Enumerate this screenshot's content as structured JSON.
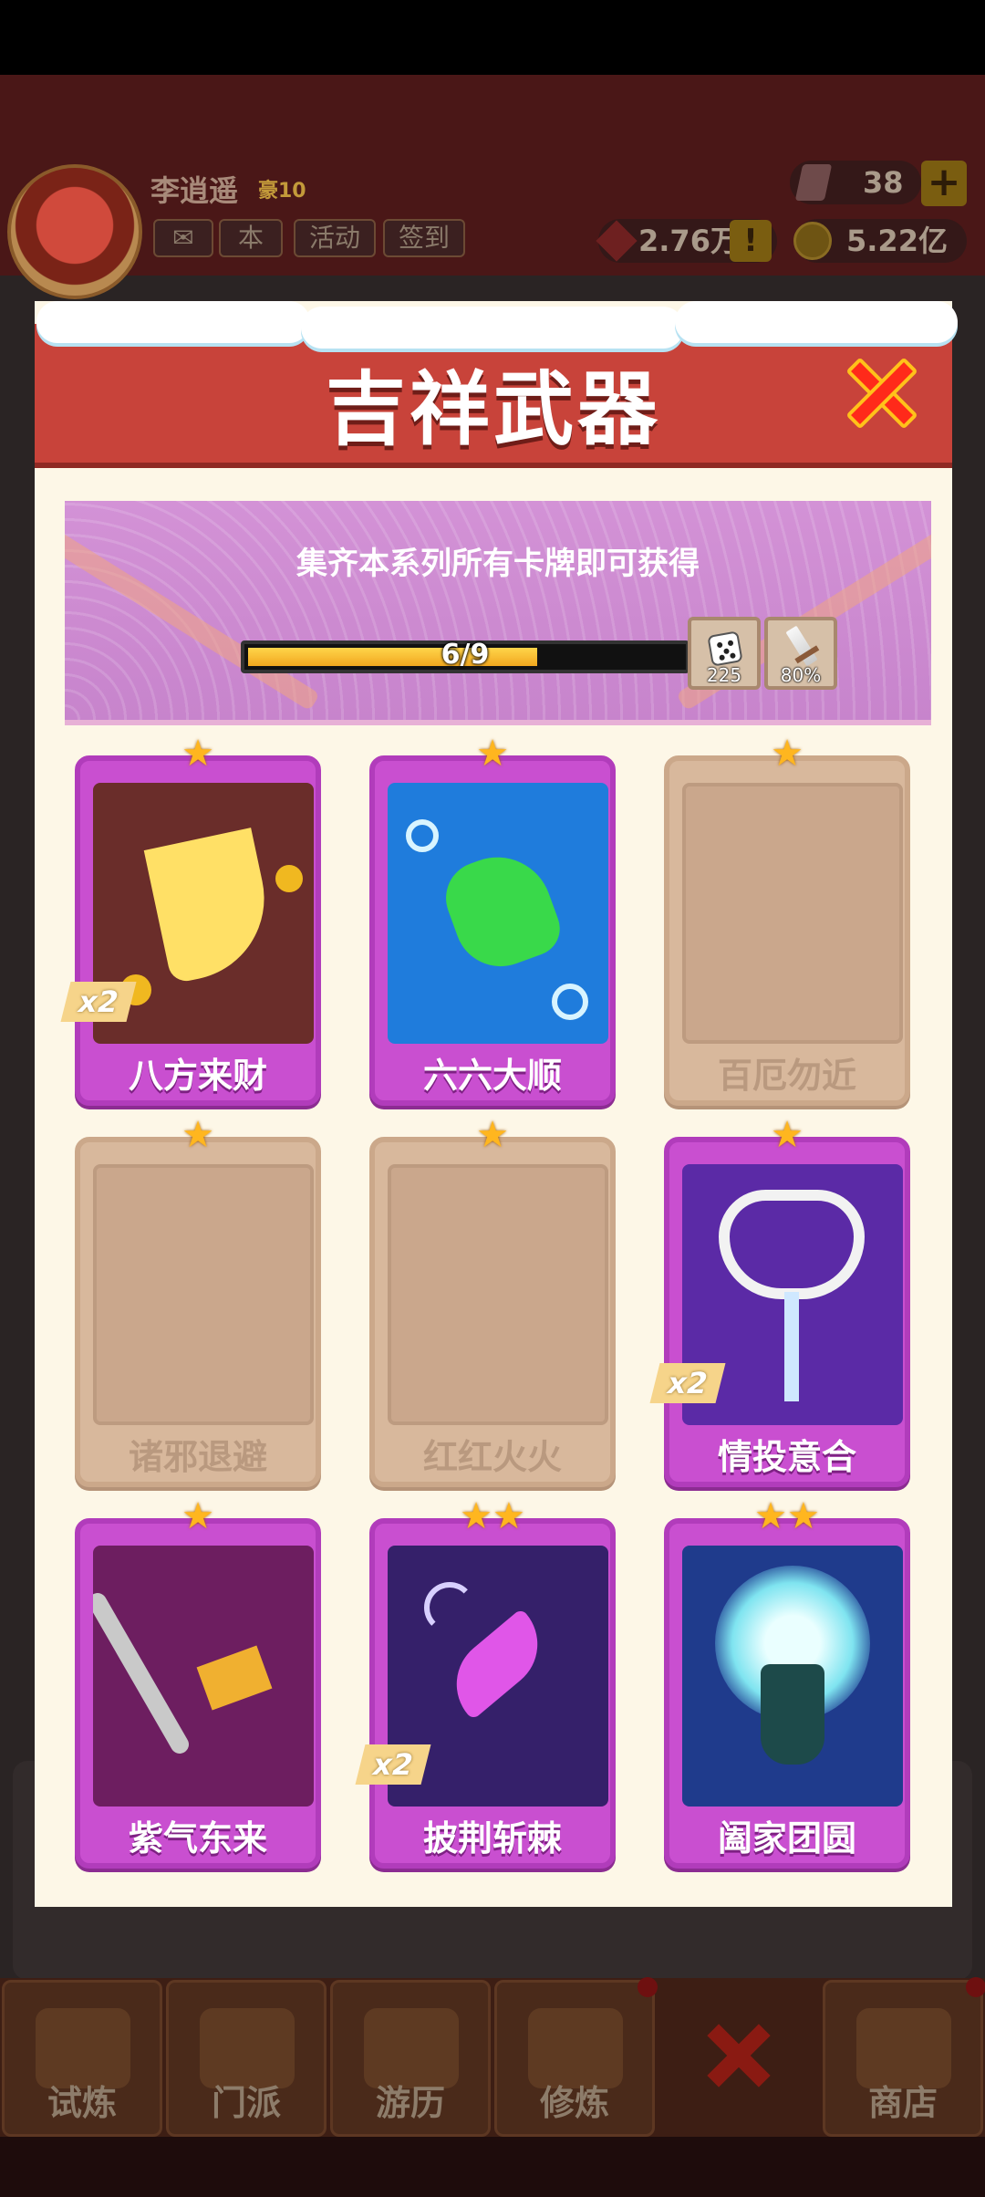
{
  "player": {
    "name": "李逍遥",
    "level": "豪10"
  },
  "top_buttons": {
    "mail": "",
    "event": "活动",
    "checkin": "签到",
    "other": "本"
  },
  "currencies": {
    "gems": "38",
    "red": "2.76万",
    "gold": "5.22亿"
  },
  "dialog": {
    "title": "吉祥武器",
    "banner_text": "集齐本系列所有卡牌即可获得",
    "progress": {
      "text": "6/9",
      "collected": 6,
      "total": 9
    },
    "rewards": [
      {
        "icon": "dice-icon",
        "count": "225"
      },
      {
        "icon": "dagger-icon",
        "count": "80%"
      }
    ],
    "cards": [
      {
        "name": "八方来财",
        "stars": "★",
        "owned": true,
        "dup": "x2",
        "theme": "#6a2d2a"
      },
      {
        "name": "六六大顺",
        "stars": "★",
        "owned": true,
        "dup": "",
        "theme": "#1f7cdc"
      },
      {
        "name": "百厄勿近",
        "stars": "★",
        "owned": false,
        "dup": ""
      },
      {
        "name": "诸邪退避",
        "stars": "★",
        "owned": false,
        "dup": ""
      },
      {
        "name": "红红火火",
        "stars": "★",
        "owned": false,
        "dup": ""
      },
      {
        "name": "情投意合",
        "stars": "★",
        "owned": true,
        "dup": "x2",
        "theme": "#5b2aa6"
      },
      {
        "name": "紫气东来",
        "stars": "★",
        "owned": true,
        "dup": "",
        "theme": "#6d1e60"
      },
      {
        "name": "披荆斩棘",
        "stars": "★★",
        "owned": true,
        "dup": "x2",
        "theme": "#35206a"
      },
      {
        "name": "阖家团圆",
        "stars": "★★",
        "owned": true,
        "dup": "",
        "theme": "#1f3b8c"
      }
    ]
  },
  "bottom_nav": [
    {
      "label": "试炼"
    },
    {
      "label": "门派"
    },
    {
      "label": "游历"
    },
    {
      "label": "修炼"
    },
    {
      "label": ""
    },
    {
      "label": "商店"
    }
  ],
  "colors": {
    "dialog_red": "#c8433a",
    "card_purple": "#c94fd0",
    "star": "#ffb61f",
    "progress_fill": "#f1a71f"
  }
}
